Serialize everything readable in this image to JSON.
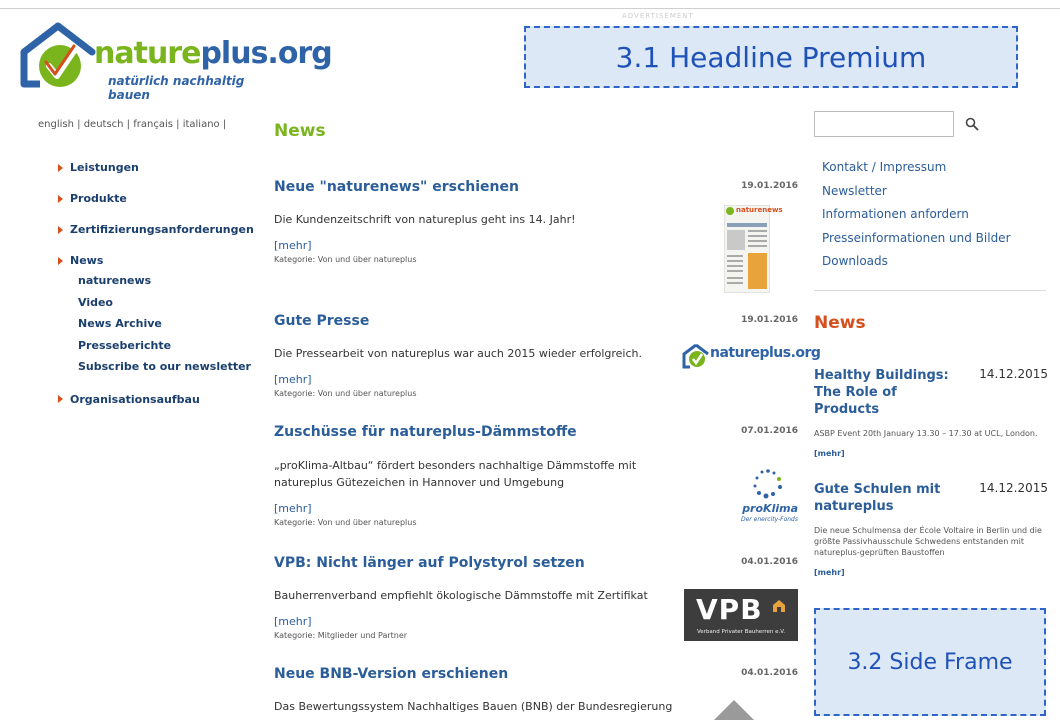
{
  "header": {
    "logo_name_green": "nature",
    "logo_name_blue": "plus.org",
    "logo_tagline": "natürlich nachhaltig bauen",
    "ad_label": "ADVERTISEMENT",
    "headline_frame": "3.1 Headline Premium",
    "side_frame": "3.2 Side Frame"
  },
  "languages": [
    "english |",
    "deutsch |",
    "français |",
    "italiano |"
  ],
  "nav": {
    "items": [
      "Leistungen",
      "Produkte",
      "Zertifizierungsanforderungen",
      "News",
      "Organisationsaufbau"
    ],
    "news_sub": [
      "naturenews",
      "Video",
      "News Archive",
      "Presseberichte",
      "Subscribe to our newsletter"
    ]
  },
  "main": {
    "title": "News",
    "articles": [
      {
        "title": "Neue \"naturenews\" erschienen",
        "date": "19.01.2016",
        "desc": "Die Kundenzeitschrift von natureplus geht ins 14. Jahr!",
        "more": "[mehr]",
        "category": "Kategorie: Von und über natureplus",
        "thumb": "naturenews"
      },
      {
        "title": "Gute Presse",
        "date": "19.01.2016",
        "desc": "Die Pressearbeit von natureplus war auch 2015 wieder erfolgreich.",
        "more": "[mehr]",
        "category": "Kategorie: Von und über natureplus",
        "thumb": "natureplus.org"
      },
      {
        "title": "Zuschüsse für natureplus-Dämmstoffe",
        "date": "07.01.2016",
        "desc": "„proKlima-Altbau“ fördert besonders nachhaltige Dämmstoffe mit natureplus Gütezeichen in Hannover und Umgebung",
        "more": "[mehr]",
        "category": "Kategorie: Von und über natureplus",
        "thumb_main": "proKlima",
        "thumb_sub": "Der enercity-Fonds"
      },
      {
        "title": "VPB: Nicht länger auf Polystyrol setzen",
        "date": "04.01.2016",
        "desc": "Bauherrenverband empfiehlt ökologische Dämmstoffe mit Zertifikat",
        "more": "[mehr]",
        "category": "Kategorie: Mitglieder und Partner",
        "thumb_main": "VPB",
        "thumb_sub": "Verband Privater Bauherren e.V."
      },
      {
        "title": "Neue BNB-Version erschienen",
        "date": "04.01.2016",
        "desc": "Das Bewertungssystem Nachhaltiges Bauen (BNB) der Bundesregierung"
      }
    ]
  },
  "sidebar": {
    "search_placeholder": "",
    "links": [
      "Kontakt / Impressum",
      "Newsletter",
      "Informationen anfordern",
      "Presseinformationen und Bilder",
      "Downloads"
    ],
    "news_title": "News",
    "news": [
      {
        "title": "Healthy Buildings: The Role of Products",
        "date": "14.12.2015",
        "desc": "ASBP Event 20th January 13.30 – 17.30 at UCL, London.",
        "more": "[mehr]"
      },
      {
        "title": "Gute Schulen mit natureplus",
        "date": "14.12.2015",
        "desc": "Die neue Schulmensa der École Voltaire in Berlin und die größte Passivhausschule Schwedens entstanden mit natureplus-geprüften Baustoffen",
        "more": "[mehr]"
      }
    ]
  },
  "colors": {
    "green": "#7ab51d",
    "blue": "#2b5d99",
    "orange": "#d6501e",
    "frame_blue": "#2f64c8"
  }
}
